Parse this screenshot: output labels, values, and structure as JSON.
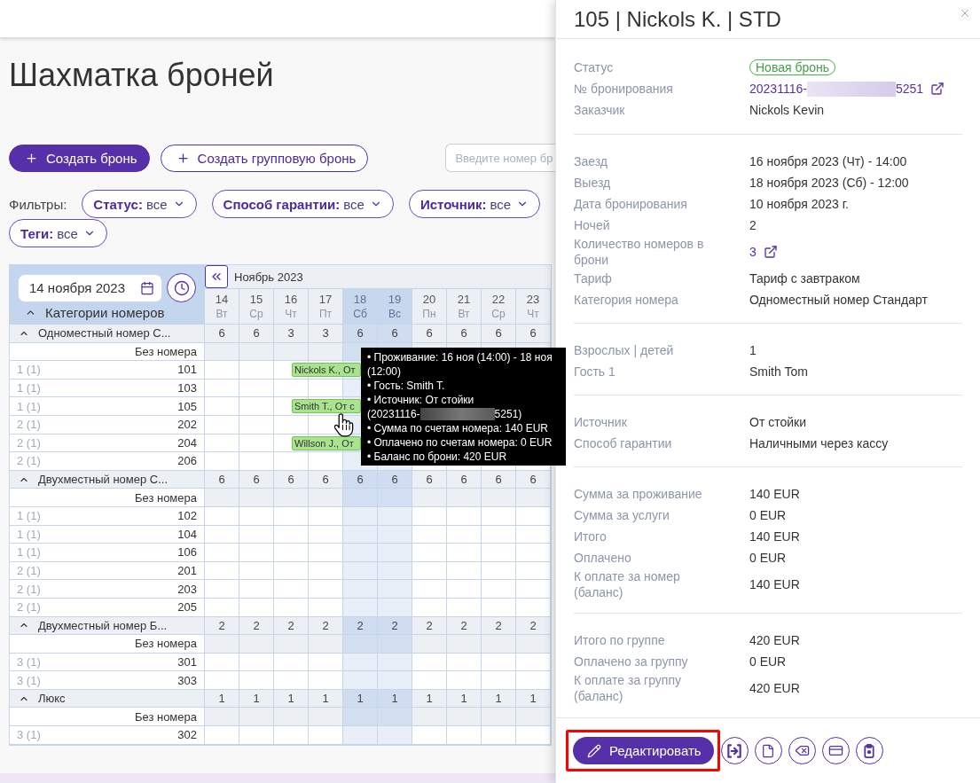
{
  "page": {
    "title": "Шахматка броней"
  },
  "actions": [
    {
      "kind": "primary",
      "label": "Создать бронь"
    },
    {
      "kind": "secondary",
      "label": "Создать групповую бронь"
    }
  ],
  "search": {
    "placeholder": "Введите номер бр"
  },
  "filters": {
    "label": "Фильтры:",
    "items": [
      {
        "name": "Статус:",
        "value": "все"
      },
      {
        "name": "Способ гарантии:",
        "value": "все"
      },
      {
        "name": "Источник:",
        "value": "все"
      },
      {
        "name": "Теги:",
        "value": "все"
      }
    ]
  },
  "calendar": {
    "date_field": {
      "value": "14 ноября 2023"
    },
    "categories_header": {
      "label": "Категории номеров",
      "expanded": true
    },
    "month": "Ноябрь 2023",
    "days": [
      {
        "day": "14",
        "weekday": "Вт",
        "weekend": false
      },
      {
        "day": "15",
        "weekday": "Ср",
        "weekend": false
      },
      {
        "day": "16",
        "weekday": "Чт",
        "weekend": false
      },
      {
        "day": "17",
        "weekday": "Пт",
        "weekend": false
      },
      {
        "day": "18",
        "weekday": "Сб",
        "weekend": true
      },
      {
        "day": "19",
        "weekday": "Вс",
        "weekend": true
      },
      {
        "day": "20",
        "weekday": "Пн",
        "weekend": false
      },
      {
        "day": "21",
        "weekday": "Вт",
        "weekend": false
      },
      {
        "day": "22",
        "weekday": "Ср",
        "weekend": false
      },
      {
        "day": "23",
        "weekday": "Чт",
        "weekend": false
      }
    ],
    "categories": [
      {
        "name": "Одноместный номер С...",
        "expanded": true,
        "counts": [
          "6",
          "6",
          "3",
          "3",
          "6",
          "6",
          "6",
          "6",
          "6",
          "6"
        ],
        "unassigned_label": "Без номера",
        "rooms": [
          {
            "occupancy": "1 (1)",
            "number": "101",
            "booking": {
              "label": "Nickols K., От",
              "hovered": false
            }
          },
          {
            "occupancy": "1 (1)",
            "number": "103"
          },
          {
            "occupancy": "1 (1)",
            "number": "105",
            "booking": {
              "label": "Smith T., От с",
              "hovered": true
            }
          },
          {
            "occupancy": "2 (1)",
            "number": "202"
          },
          {
            "occupancy": "2 (1)",
            "number": "204",
            "booking": {
              "label": "Willson J., От",
              "hovered": false
            }
          },
          {
            "occupancy": "2 (1)",
            "number": "206"
          }
        ]
      },
      {
        "name": "Двухместный номер С...",
        "expanded": true,
        "counts": [
          "6",
          "6",
          "6",
          "6",
          "6",
          "6",
          "6",
          "6",
          "6",
          "6"
        ],
        "unassigned_label": "Без номера",
        "rooms": [
          {
            "occupancy": "1 (1)",
            "number": "102"
          },
          {
            "occupancy": "1 (1)",
            "number": "104"
          },
          {
            "occupancy": "1 (1)",
            "number": "106"
          },
          {
            "occupancy": "2 (1)",
            "number": "201"
          },
          {
            "occupancy": "2 (1)",
            "number": "203"
          },
          {
            "occupancy": "2 (1)",
            "number": "205"
          }
        ]
      },
      {
        "name": "Двухместный номер Б...",
        "expanded": true,
        "counts": [
          "2",
          "2",
          "2",
          "2",
          "2",
          "2",
          "2",
          "2",
          "2",
          "2"
        ],
        "unassigned_label": "Без номера",
        "rooms": [
          {
            "occupancy": "3 (1)",
            "number": "301"
          },
          {
            "occupancy": "3 (1)",
            "number": "303"
          }
        ]
      },
      {
        "name": "Люкс",
        "expanded": true,
        "counts": [
          "1",
          "1",
          "1",
          "1",
          "1",
          "1",
          "1",
          "1",
          "1",
          "1"
        ],
        "unassigned_label": "Без номера",
        "rooms": [
          {
            "occupancy": "3 (1)",
            "number": "302"
          }
        ]
      }
    ],
    "tooltip": {
      "lines": [
        {
          "kind": "text",
          "text": "• Проживание: 16 ноя (14:00) - 18 ноя (12:00)"
        },
        {
          "kind": "text",
          "text": "• Гость: Smith T."
        },
        {
          "kind": "reference",
          "text": "• Источник: От стойки",
          "prefix": "(20231116-",
          "suffix": "5251)",
          "redacted": true
        },
        {
          "kind": "text",
          "text": "• Сумма по счетам номера: 140 EUR"
        },
        {
          "kind": "text",
          "text": "• Оплачено по счетам номера: 0 EUR"
        },
        {
          "kind": "text",
          "text": "• Баланс по брони: 420 EUR"
        }
      ]
    }
  },
  "details": {
    "title": "105 | Nickols K. | STD",
    "sections": [
      {
        "rows": [
          {
            "kind": "badge",
            "label": "Статус",
            "value": "Новая бронь"
          },
          {
            "kind": "reference",
            "label": "№ бронирования",
            "prefix": "20231116-",
            "suffix": "5251",
            "redacted": true
          },
          {
            "kind": "text",
            "label": "Заказчик",
            "value": "Nickols Kevin"
          }
        ]
      },
      {
        "rows": [
          {
            "kind": "text",
            "label": "Заезд",
            "value": "16 ноября 2023 (Чт) - 14:00"
          },
          {
            "kind": "text",
            "label": "Выезд",
            "value": "18 ноября 2023 (Сб) - 12:00"
          },
          {
            "kind": "text",
            "label": "Дата бронирования",
            "value": "10 ноября 2023 г."
          },
          {
            "kind": "text",
            "label": "Ночей",
            "value": "2"
          },
          {
            "kind": "link",
            "label": "Количество номеров в брони",
            "value": "3"
          },
          {
            "kind": "text",
            "label": "Тариф",
            "value": "Тариф с завтраком"
          },
          {
            "kind": "text",
            "label": "Категория номера",
            "value": "Одноместный номер Стандарт"
          }
        ]
      },
      {
        "rows": [
          {
            "kind": "text",
            "label": "Взрослых | детей",
            "value": "1"
          },
          {
            "kind": "text",
            "label": "Гость 1",
            "value": "Smith Tom"
          }
        ]
      },
      {
        "rows": [
          {
            "kind": "text",
            "label": "Источник",
            "value": "От стойки"
          },
          {
            "kind": "text",
            "label": "Способ гарантии",
            "value": "Наличными через кассу"
          }
        ]
      },
      {
        "rows": [
          {
            "kind": "text",
            "label": "Сумма за проживание",
            "value": "140 EUR"
          },
          {
            "kind": "text",
            "label": "Сумма за услуги",
            "value": "0 EUR"
          },
          {
            "kind": "text",
            "label": "Итого",
            "value": "140 EUR"
          },
          {
            "kind": "text",
            "label": "Оплачено",
            "value": "0 EUR"
          },
          {
            "kind": "text",
            "label": "К оплате за номер (баланс)",
            "value": "140 EUR"
          }
        ]
      },
      {
        "rows": [
          {
            "kind": "text",
            "label": "Итого по группе",
            "value": "420 EUR"
          },
          {
            "kind": "text",
            "label": "Оплачено за группу",
            "value": "0 EUR"
          },
          {
            "kind": "text",
            "label": "К оплате за группу (баланс)",
            "value": "420 EUR"
          }
        ]
      }
    ],
    "edit_button": {
      "label": "Редактировать",
      "highlighted": true
    },
    "tools": [
      {
        "kind": "enter"
      },
      {
        "kind": "document"
      },
      {
        "kind": "erase"
      },
      {
        "kind": "card"
      },
      {
        "kind": "clipboard"
      }
    ]
  }
}
